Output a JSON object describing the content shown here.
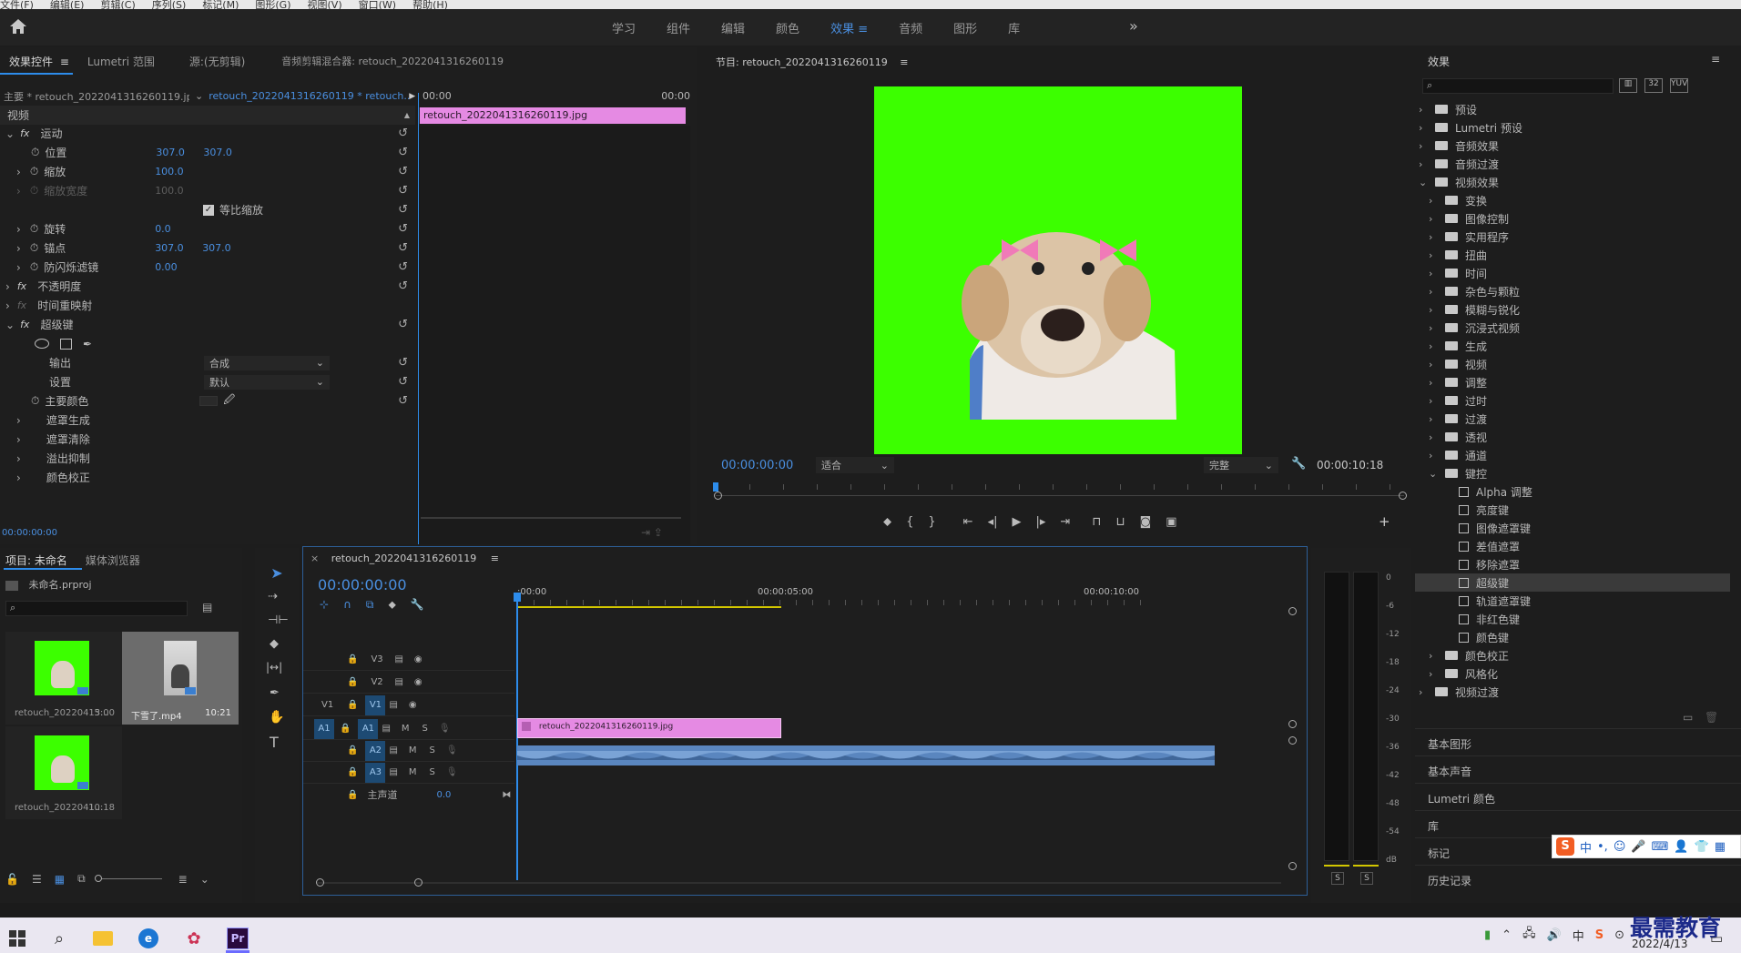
{
  "menubar": [
    "文件(F)",
    "编辑(E)",
    "剪辑(C)",
    "序列(S)",
    "标记(M)",
    "图形(G)",
    "视图(V)",
    "窗口(W)",
    "帮助(H)"
  ],
  "workspaces": [
    "学习",
    "组件",
    "编辑",
    "颜色",
    "效果",
    "音频",
    "图形",
    "库"
  ],
  "workspace_active": "效果",
  "effect_controls": {
    "tabs": [
      "效果控件",
      "Lumetri 范围",
      "源:(无剪辑)",
      "音频剪辑混合器: retouch_2022041316260119"
    ],
    "master": "主要 * retouch_2022041316260119.jpg",
    "clip": "retouch_2022041316260119 * retouch...",
    "ruler_start": "00:00",
    "ruler_end": "00:00",
    "clip_bar": "retouch_2022041316260119.jpg",
    "section_video": "视频",
    "motion": "运动",
    "position": "位置",
    "position_x": "307.0",
    "position_y": "307.0",
    "scale": "缩放",
    "scale_val": "100.0",
    "scale_width": "缩放宽度",
    "scale_width_val": "100.0",
    "uniform_scale": "等比缩放",
    "rotation": "旋转",
    "rotation_val": "0.0",
    "anchor": "锚点",
    "anchor_x": "307.0",
    "anchor_y": "307.0",
    "antiflicker": "防闪烁滤镜",
    "antiflicker_val": "0.00",
    "opacity": "不透明度",
    "time_remap": "时间重映射",
    "ultra_key": "超级键",
    "output": "输出",
    "output_val": "合成",
    "setting": "设置",
    "setting_val": "默认",
    "key_color": "主要颜色",
    "matte_gen": "遮罩生成",
    "matte_clean": "遮罩清除",
    "spill": "溢出抑制",
    "color_corr": "颜色校正",
    "timecode": "00:00:00:00"
  },
  "program": {
    "title": "节目: retouch_2022041316260119",
    "timecode": "00:00:00:00",
    "fit": "适合",
    "quality": "完整",
    "duration": "00:00:10:18"
  },
  "effects_panel": {
    "title": "效果",
    "items": [
      {
        "label": "预设",
        "level": 0,
        "type": "bin"
      },
      {
        "label": "Lumetri 预设",
        "level": 0,
        "type": "bin"
      },
      {
        "label": "音频效果",
        "level": 0,
        "type": "folder"
      },
      {
        "label": "音频过渡",
        "level": 0,
        "type": "folder"
      },
      {
        "label": "视频效果",
        "level": 0,
        "type": "folder",
        "open": true
      },
      {
        "label": "变换",
        "level": 1,
        "type": "folder"
      },
      {
        "label": "图像控制",
        "level": 1,
        "type": "folder"
      },
      {
        "label": "实用程序",
        "level": 1,
        "type": "folder"
      },
      {
        "label": "扭曲",
        "level": 1,
        "type": "folder"
      },
      {
        "label": "时间",
        "level": 1,
        "type": "folder"
      },
      {
        "label": "杂色与颗粒",
        "level": 1,
        "type": "folder"
      },
      {
        "label": "模糊与锐化",
        "level": 1,
        "type": "folder"
      },
      {
        "label": "沉浸式视频",
        "level": 1,
        "type": "folder"
      },
      {
        "label": "生成",
        "level": 1,
        "type": "folder"
      },
      {
        "label": "视频",
        "level": 1,
        "type": "folder"
      },
      {
        "label": "调整",
        "level": 1,
        "type": "folder"
      },
      {
        "label": "过时",
        "level": 1,
        "type": "folder"
      },
      {
        "label": "过渡",
        "level": 1,
        "type": "folder"
      },
      {
        "label": "透视",
        "level": 1,
        "type": "folder"
      },
      {
        "label": "通道",
        "level": 1,
        "type": "folder"
      },
      {
        "label": "键控",
        "level": 1,
        "type": "folder",
        "open": true
      },
      {
        "label": "Alpha 调整",
        "level": 2,
        "type": "fx"
      },
      {
        "label": "亮度键",
        "level": 2,
        "type": "fx"
      },
      {
        "label": "图像遮罩键",
        "level": 2,
        "type": "fx"
      },
      {
        "label": "差值遮罩",
        "level": 2,
        "type": "fx"
      },
      {
        "label": "移除遮罩",
        "level": 2,
        "type": "fx"
      },
      {
        "label": "超级键",
        "level": 2,
        "type": "fx",
        "selected": true
      },
      {
        "label": "轨道遮罩键",
        "level": 2,
        "type": "fx"
      },
      {
        "label": "非红色键",
        "level": 2,
        "type": "fx"
      },
      {
        "label": "颜色键",
        "level": 2,
        "type": "fx"
      },
      {
        "label": "颜色校正",
        "level": 1,
        "type": "folder"
      },
      {
        "label": "风格化",
        "level": 1,
        "type": "folder"
      },
      {
        "label": "视频过渡",
        "level": 0,
        "type": "folder"
      }
    ],
    "sections": [
      "基本图形",
      "基本声音",
      "Lumetri 颜色",
      "库",
      "标记",
      "历史记录"
    ]
  },
  "project": {
    "tabs": [
      "项目: 未命名",
      "媒体浏览器"
    ],
    "file": "未命名.prproj",
    "items": [
      {
        "name": "retouch_20220413...",
        "dur": "5:00"
      },
      {
        "name": "下雪了.mp4",
        "dur": "10:21"
      },
      {
        "name": "retouch_2022041...",
        "dur": "10:18"
      }
    ]
  },
  "timeline": {
    "tab": "retouch_2022041316260119",
    "timecode": "00:00:00:00",
    "ruler": [
      ":00:00",
      "00:00:05:00",
      "00:00:10:00"
    ],
    "video_tracks": [
      "V3",
      "V2",
      "V1"
    ],
    "audio_tracks": [
      "A1",
      "A2",
      "A3"
    ],
    "source_v": "V1",
    "source_a": "A1",
    "master": "主声道",
    "master_val": "0.0",
    "clip": "retouch_2022041316260119.jpg",
    "m": "M",
    "s": "S"
  },
  "meter": {
    "scale": [
      "0",
      "-6",
      "-12",
      "-18",
      "-24",
      "-30",
      "-36",
      "-42",
      "-48",
      "-54",
      "dB"
    ],
    "solo": "S"
  },
  "taskbar": {
    "date": "2022/4/13",
    "brand": "最需教育",
    "ime": "中"
  },
  "colors": {
    "accent": "#2d8ceb",
    "green": "#3cff00",
    "clip_pink": "#e58ae3",
    "audio": "#5a86bf"
  }
}
